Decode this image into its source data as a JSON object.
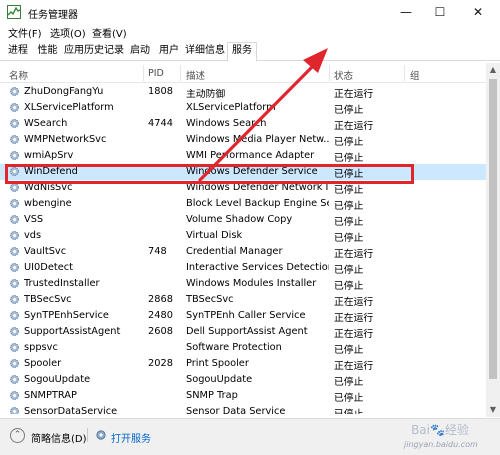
{
  "window": {
    "title": "任务管理器"
  },
  "menu": [
    "文件(F)",
    "选项(O)",
    "查看(V)"
  ],
  "tabs": [
    "进程",
    "性能",
    "应用历史记录",
    "启动",
    "用户",
    "详细信息",
    "服务"
  ],
  "columns": {
    "name": "名称",
    "pid": "PID",
    "desc": "描述",
    "status": "状态",
    "group": "组"
  },
  "rows": [
    {
      "name": "ZhuDongFangYu",
      "pid": "1808",
      "desc": "主动防御",
      "status": "正在运行"
    },
    {
      "name": "XLServicePlatform",
      "pid": "",
      "desc": "XLServicePlatform",
      "status": "已停止"
    },
    {
      "name": "WSearch",
      "pid": "4744",
      "desc": "Windows Search",
      "status": "正在运行"
    },
    {
      "name": "WMPNetworkSvc",
      "pid": "",
      "desc": "Windows Media Player Netw...",
      "status": "已停止"
    },
    {
      "name": "wmiApSrv",
      "pid": "",
      "desc": "WMI Performance Adapter",
      "status": "已停止"
    },
    {
      "name": "WinDefend",
      "pid": "",
      "desc": "Windows Defender Service",
      "status": "已停止",
      "selected": true
    },
    {
      "name": "WdNisSvc",
      "pid": "",
      "desc": "Windows Defender Network I...",
      "status": "已停止"
    },
    {
      "name": "wbengine",
      "pid": "",
      "desc": "Block Level Backup Engine Se...",
      "status": "已停止"
    },
    {
      "name": "VSS",
      "pid": "",
      "desc": "Volume Shadow Copy",
      "status": "已停止"
    },
    {
      "name": "vds",
      "pid": "",
      "desc": "Virtual Disk",
      "status": "已停止"
    },
    {
      "name": "VaultSvc",
      "pid": "748",
      "desc": "Credential Manager",
      "status": "正在运行"
    },
    {
      "name": "UI0Detect",
      "pid": "",
      "desc": "Interactive Services Detection",
      "status": "已停止"
    },
    {
      "name": "TrustedInstaller",
      "pid": "",
      "desc": "Windows Modules Installer",
      "status": "已停止"
    },
    {
      "name": "TBSecSvc",
      "pid": "2868",
      "desc": "TBSecSvc",
      "status": "正在运行"
    },
    {
      "name": "SynTPEnhService",
      "pid": "2480",
      "desc": "SynTPEnh Caller Service",
      "status": "正在运行"
    },
    {
      "name": "SupportAssistAgent",
      "pid": "2608",
      "desc": "Dell SupportAssist Agent",
      "status": "正在运行"
    },
    {
      "name": "sppsvc",
      "pid": "",
      "desc": "Software Protection",
      "status": "已停止"
    },
    {
      "name": "Spooler",
      "pid": "2028",
      "desc": "Print Spooler",
      "status": "正在运行"
    },
    {
      "name": "SogouUpdate",
      "pid": "",
      "desc": "SogouUpdate",
      "status": "已停止"
    },
    {
      "name": "SNMPTRAP",
      "pid": "",
      "desc": "SNMP Trap",
      "status": "已停止"
    },
    {
      "name": "SensorDataService",
      "pid": "",
      "desc": "Sensor Data Service",
      "status": "已停止"
    }
  ],
  "footer": {
    "less": "简略信息(D)",
    "open": "打开服务"
  },
  "watermark": "jingyan.baidu.com",
  "colors": {
    "highlight": "#e0262d",
    "selected_bg": "#cce8ff"
  }
}
